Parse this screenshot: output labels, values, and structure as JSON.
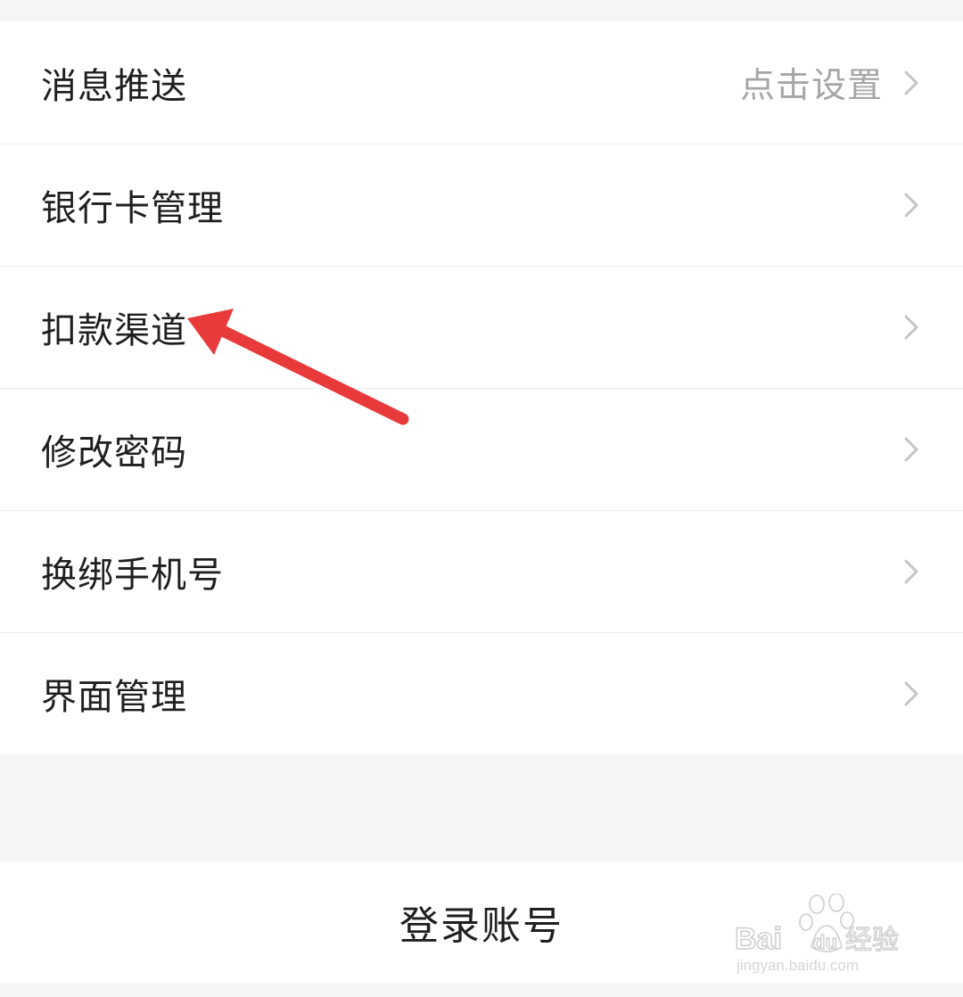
{
  "settings": {
    "items": [
      {
        "label": "消息推送",
        "value": "点击设置"
      },
      {
        "label": "银行卡管理",
        "value": ""
      },
      {
        "label": "扣款渠道",
        "value": ""
      },
      {
        "label": "修改密码",
        "value": ""
      },
      {
        "label": "换绑手机号",
        "value": ""
      },
      {
        "label": "界面管理",
        "value": ""
      }
    ]
  },
  "login": {
    "label": "登录账号"
  },
  "watermark": {
    "brand": "Baidu经验",
    "url": "jingyan.baidu.com"
  },
  "colors": {
    "annotation_arrow": "#e83a3a",
    "chevron": "#c4c4c4",
    "value_text": "#a6a6a6"
  }
}
